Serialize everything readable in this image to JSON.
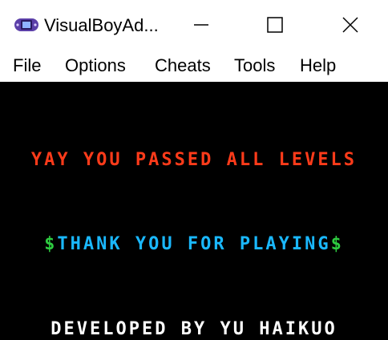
{
  "window": {
    "title": "VisualBoyAd...",
    "app_icon": "gameboy-advance-icon",
    "controls": {
      "minimize_icon": "minimize-icon",
      "maximize_icon": "maximize-icon",
      "close_icon": "close-icon"
    }
  },
  "menu": {
    "items": [
      "File",
      "Options",
      "Cheats",
      "Tools",
      "Help"
    ]
  },
  "game": {
    "line1": "YAY YOU PASSED ALL LEVELS",
    "line2_prefix": "$",
    "line2_text": "THANK YOU FOR PLAYING",
    "line2_suffix": "$",
    "line3": "DEVELOPED BY YU HAIKUO"
  },
  "colors": {
    "screen_bg": "#000000",
    "line1": "#ff3b1a",
    "line2": "#1ab8ff",
    "line2_symbols": "#2ecc40",
    "line3": "#ffffff"
  }
}
